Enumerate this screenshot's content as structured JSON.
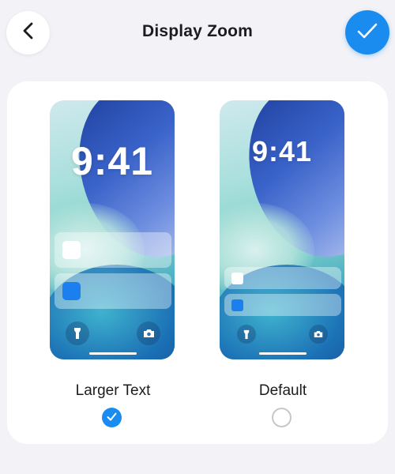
{
  "header": {
    "title": "Display Zoom",
    "back_icon": "chevron-left-icon",
    "done_icon": "checkmark-icon",
    "accent_color": "#1a8cf0"
  },
  "options": [
    {
      "label": "Larger Text",
      "preview_time": "9:41",
      "selected": true
    },
    {
      "label": "Default",
      "preview_time": "9:41",
      "selected": false
    }
  ],
  "preview_icons": {
    "left": "flashlight-icon",
    "right": "camera-icon"
  }
}
